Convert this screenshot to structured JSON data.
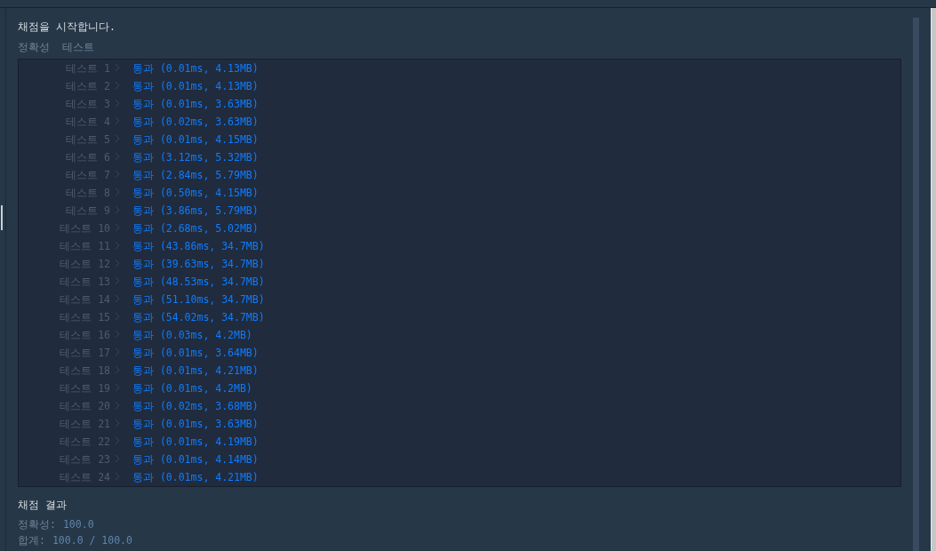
{
  "intro": "채점을 시작합니다.",
  "section_title": "정확성  테스트",
  "tests": [
    {
      "label": "테스트 1",
      "status": "통과",
      "detail": "(0.01ms, 4.13MB)"
    },
    {
      "label": "테스트 2",
      "status": "통과",
      "detail": "(0.01ms, 4.13MB)"
    },
    {
      "label": "테스트 3",
      "status": "통과",
      "detail": "(0.01ms, 3.63MB)"
    },
    {
      "label": "테스트 4",
      "status": "통과",
      "detail": "(0.02ms, 3.63MB)"
    },
    {
      "label": "테스트 5",
      "status": "통과",
      "detail": "(0.01ms, 4.15MB)"
    },
    {
      "label": "테스트 6",
      "status": "통과",
      "detail": "(3.12ms, 5.32MB)"
    },
    {
      "label": "테스트 7",
      "status": "통과",
      "detail": "(2.84ms, 5.79MB)"
    },
    {
      "label": "테스트 8",
      "status": "통과",
      "detail": "(0.50ms, 4.15MB)"
    },
    {
      "label": "테스트 9",
      "status": "통과",
      "detail": "(3.86ms, 5.79MB)"
    },
    {
      "label": "테스트 10",
      "status": "통과",
      "detail": "(2.68ms, 5.02MB)"
    },
    {
      "label": "테스트 11",
      "status": "통과",
      "detail": "(43.86ms, 34.7MB)"
    },
    {
      "label": "테스트 12",
      "status": "통과",
      "detail": "(39.63ms, 34.7MB)"
    },
    {
      "label": "테스트 13",
      "status": "통과",
      "detail": "(48.53ms, 34.7MB)"
    },
    {
      "label": "테스트 14",
      "status": "통과",
      "detail": "(51.10ms, 34.7MB)"
    },
    {
      "label": "테스트 15",
      "status": "통과",
      "detail": "(54.02ms, 34.7MB)"
    },
    {
      "label": "테스트 16",
      "status": "통과",
      "detail": "(0.03ms, 4.2MB)"
    },
    {
      "label": "테스트 17",
      "status": "통과",
      "detail": "(0.01ms, 3.64MB)"
    },
    {
      "label": "테스트 18",
      "status": "통과",
      "detail": "(0.01ms, 4.21MB)"
    },
    {
      "label": "테스트 19",
      "status": "통과",
      "detail": "(0.01ms, 4.2MB)"
    },
    {
      "label": "테스트 20",
      "status": "통과",
      "detail": "(0.02ms, 3.68MB)"
    },
    {
      "label": "테스트 21",
      "status": "통과",
      "detail": "(0.01ms, 3.63MB)"
    },
    {
      "label": "테스트 22",
      "status": "통과",
      "detail": "(0.01ms, 4.19MB)"
    },
    {
      "label": "테스트 23",
      "status": "통과",
      "detail": "(0.01ms, 4.14MB)"
    },
    {
      "label": "테스트 24",
      "status": "통과",
      "detail": "(0.01ms, 4.21MB)"
    }
  ],
  "result_title": "채점 결과",
  "summary": [
    {
      "label": "정확성:",
      "value": "100.0"
    },
    {
      "label": "합계:",
      "value": "100.0 / 100.0"
    }
  ]
}
